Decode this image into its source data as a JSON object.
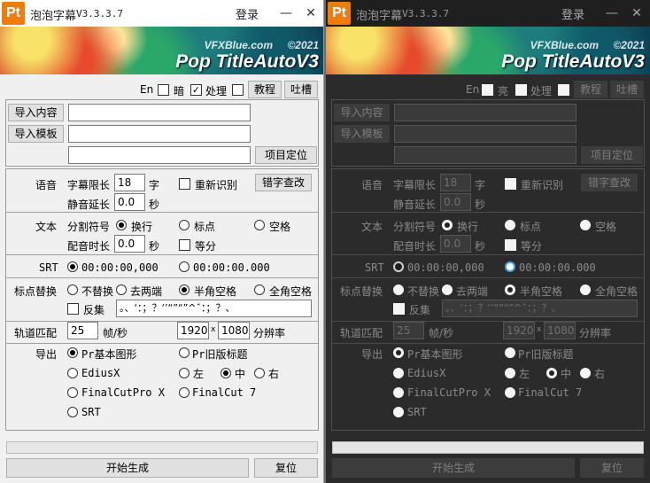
{
  "app": {
    "title": "泡泡字幕",
    "version": "V3.3.3.7",
    "login": "登录",
    "logo": "Pt"
  },
  "banner": {
    "site": "VFXBlue.com",
    "year": "©2021",
    "product": "Pop TitleAutoV3"
  },
  "top": {
    "en": "En",
    "dark": "暗",
    "light": "亮",
    "process": "处理",
    "tutorial": "教程",
    "feedback": "吐槽"
  },
  "import": {
    "content": "导入内容",
    "template": "导入模板",
    "locate": "项目定位"
  },
  "voice": {
    "label": "语音",
    "limit_label": "字幕限长",
    "limit_value": "18",
    "limit_unit": "字",
    "delay_label": "静音延长",
    "delay_value": "0.0",
    "delay_unit": "秒",
    "reidentify": "重新识别",
    "typo": "错字查改"
  },
  "text": {
    "label": "文本",
    "sep_label": "分割符号",
    "newline": "换行",
    "punct": "标点",
    "space": "空格",
    "dur_label": "配音时长",
    "dur_value": "0.0",
    "dur_unit": "秒",
    "equal": "等分"
  },
  "srt": {
    "label": "SRT",
    "time1": "00:00:00,000",
    "time2": "00:00:00.000"
  },
  "punct": {
    "label": "标点替换",
    "none": "不替换",
    "strip": "去两端",
    "half": "半角空格",
    "full": "全角空格",
    "reverse": "反集",
    "chars": "。、‘：；？‘’“”“”^ˇ：；？、"
  },
  "track": {
    "label": "轨道匹配",
    "fps_value": "25",
    "fps_unit": "帧/秒",
    "width": "1920",
    "x": "x",
    "height": "1080",
    "res_unit": "分辨率"
  },
  "export": {
    "label": "导出",
    "pr_basic": "Pr基本图形",
    "pr_legacy": "Pr旧版标题",
    "edius": "EdiusX",
    "left": "左",
    "center": "中",
    "right": "右",
    "fcpx": "FinalCutPro X",
    "fc7": "FinalCut 7",
    "srt": "SRT"
  },
  "footer": {
    "start": "开始生成",
    "reset": "复位"
  },
  "icons": {
    "minimize": "minimize-icon",
    "close": "close-icon"
  },
  "colors": {
    "logo": "#f07c10",
    "light_bg": "#f0f0f0",
    "dark_bg": "#2b2b2b"
  }
}
